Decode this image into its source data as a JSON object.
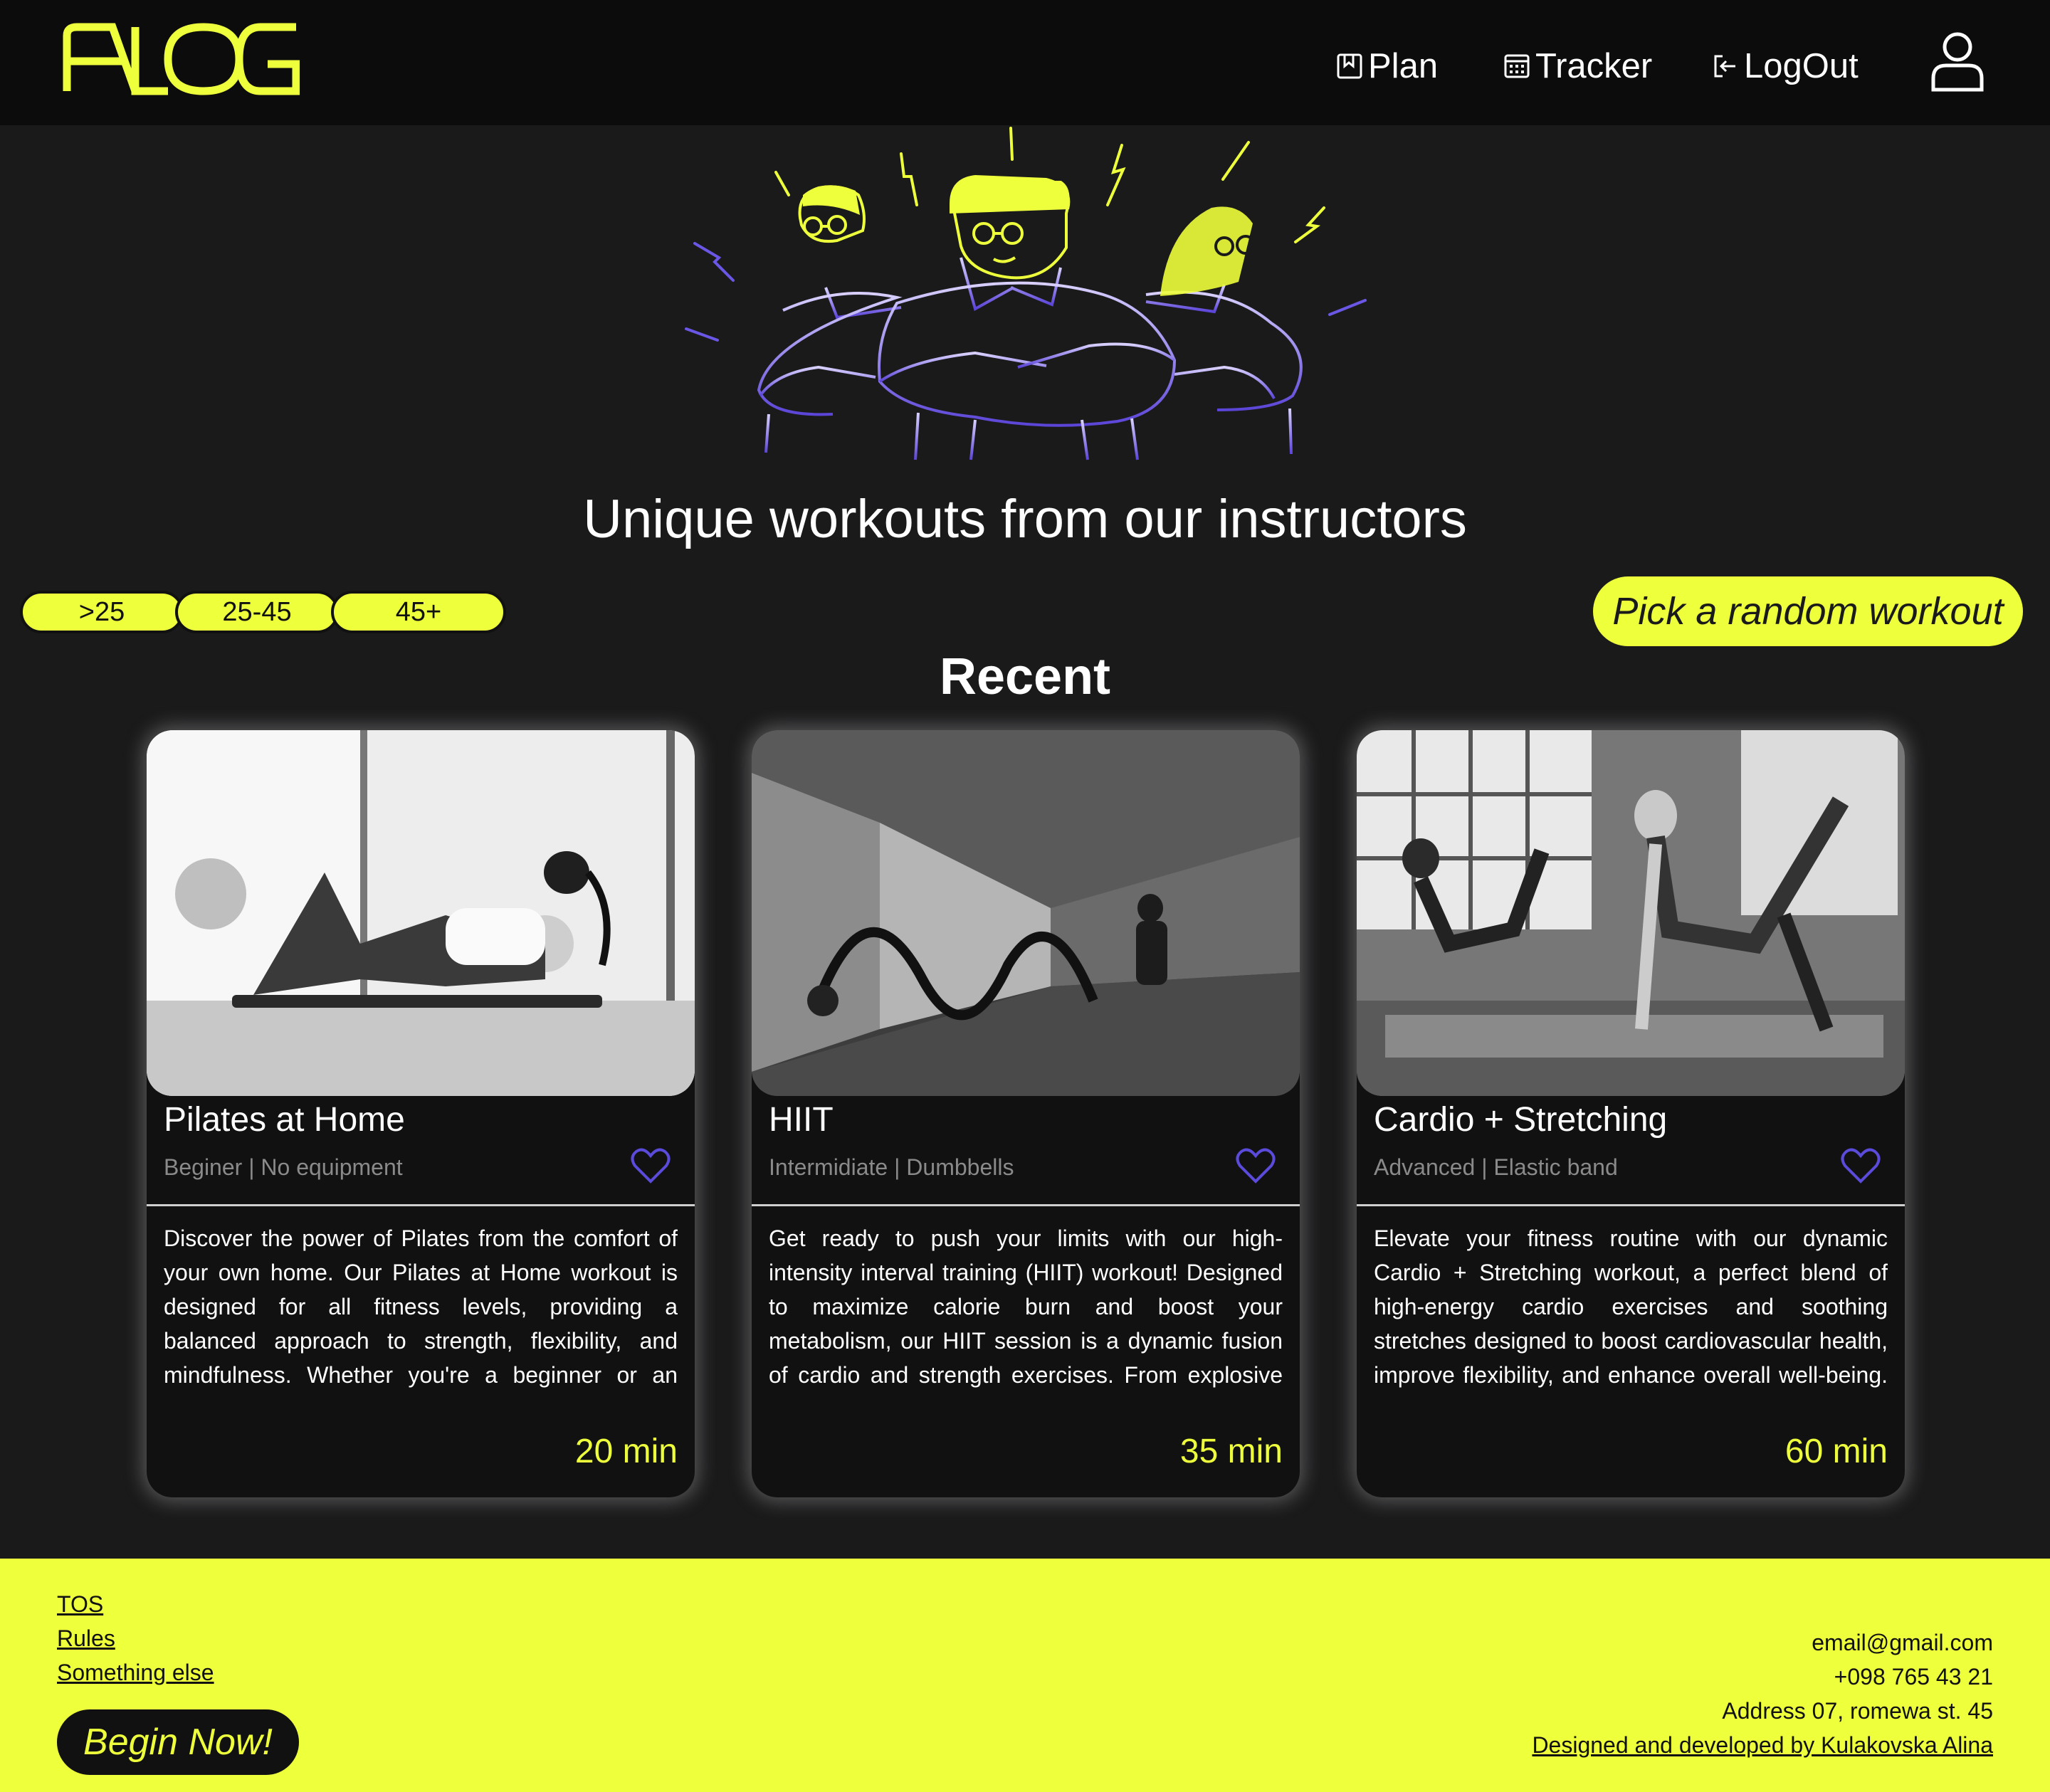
{
  "header": {
    "logo_text": "ALOG",
    "nav": [
      {
        "label": "Plan",
        "icon": "bookmark-icon"
      },
      {
        "label": "Tracker",
        "icon": "calendar-icon"
      },
      {
        "label": "LogOut",
        "icon": "logout-icon"
      }
    ],
    "profile_icon": "user-icon"
  },
  "hero": {
    "title": "Unique workouts from our instructors"
  },
  "filters": [
    ">25",
    "25-45",
    "45+"
  ],
  "random_button": "Pick a random workout",
  "section_title": "Recent",
  "cards": [
    {
      "title": "Pilates at Home",
      "meta": "Beginer | No equipment",
      "description": "Discover the power of Pilates from the comfort of your own home. Our Pilates at Home workout is designed for all fitness levels, providing a balanced approach to strength, flexibility, and mindfulness. Whether you're a beginner or an experienced practitioner, this workout will help you build core",
      "duration": "20 min"
    },
    {
      "title": "HIIT",
      "meta": "Intermidiate | Dumbbells",
      "description": "Get ready to push your limits with our high-intensity interval training (HIIT) workout! Designed to maximize calorie burn and boost your metabolism, our HIIT session is a dynamic fusion of cardio and strength exercises. From explosive plyometric moves to bodyweight exercises and",
      "duration": "35 min"
    },
    {
      "title": "Cardio + Stretching",
      "meta": "Advanced | Elastic band",
      "description": "Elevate your fitness routine with our dynamic Cardio + Stretching workout, a perfect blend of high-energy cardio exercises and soothing stretches designed to boost cardiovascular health, improve flexibility, and enhance overall well-being. This invigorating session begins with heart-",
      "duration": "60 min"
    }
  ],
  "footer": {
    "links": [
      "TOS",
      "Rules",
      "Something else"
    ],
    "begin_button": "Begin Now!",
    "email": "email@gmail.com",
    "phone": "+098 765 43 21",
    "address": "Address 07, romewa st. 45",
    "credit": "Designed and developed by Kulakovska Alina"
  },
  "colors": {
    "accent": "#eeff3b",
    "background": "#1a1a1b",
    "header": "#0c0c0c",
    "heart": "#5b4bdb"
  }
}
